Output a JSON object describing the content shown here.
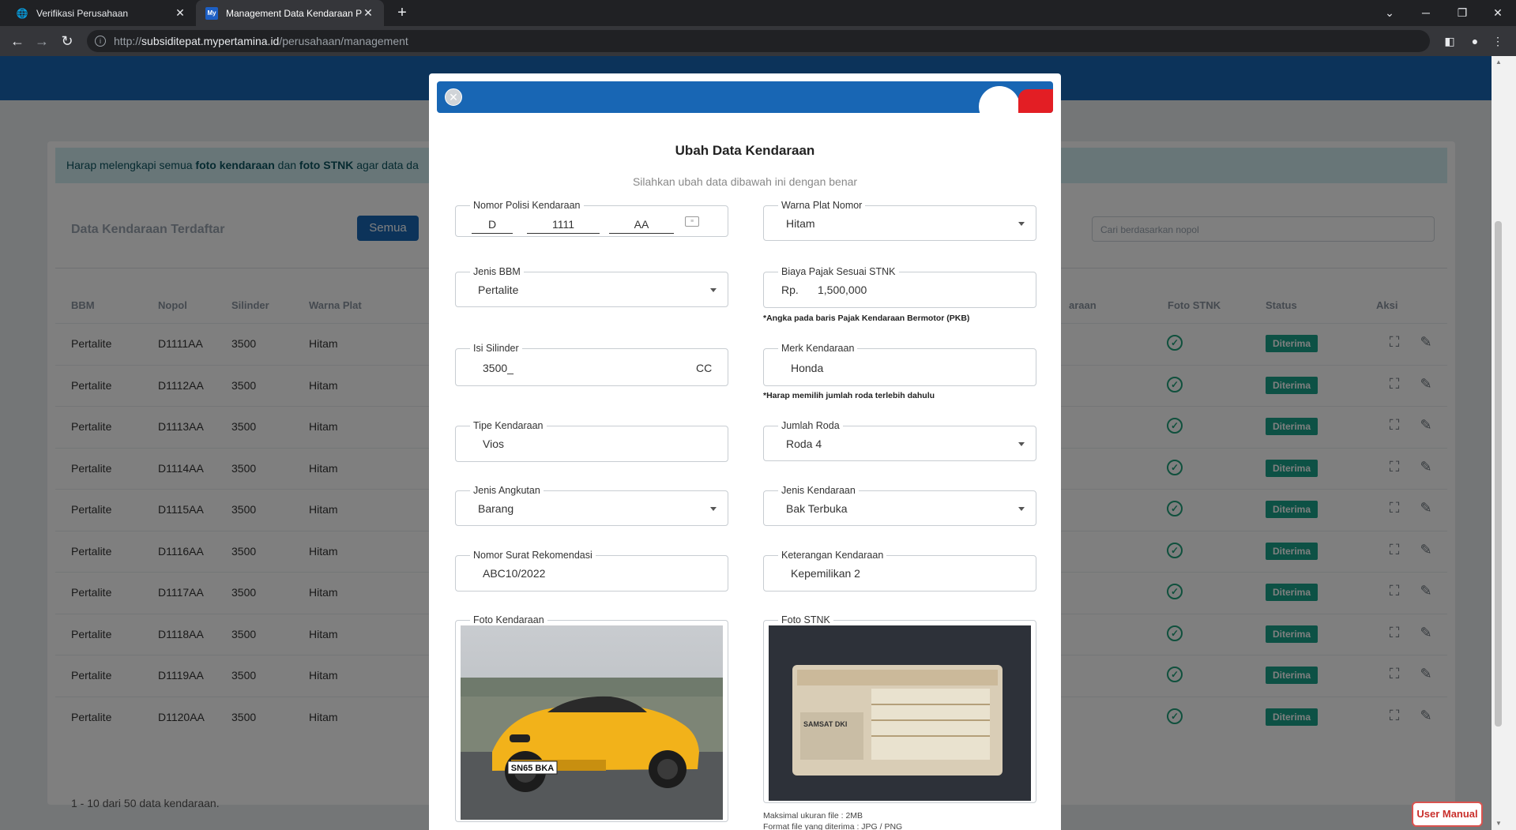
{
  "browser": {
    "tabs": [
      {
        "title": "Verifikasi Perusahaan",
        "active": false
      },
      {
        "title": "Management Data Kendaraan Pr",
        "active": true
      }
    ],
    "url_scheme": "http://",
    "url_host": "subsiditepat.mypertamina.id",
    "url_path": "/perusahaan/management"
  },
  "alert": {
    "text_pre": "Harap melengkapi semua ",
    "bold1": "foto kendaraan",
    "text_mid": " dan ",
    "bold2": "foto STNK",
    "text_post": " agar data da"
  },
  "table": {
    "title": "Data Kendaraan Terdaftar",
    "filter_label": "Semua",
    "search_placeholder": "Cari berdasarkan nopol",
    "headers": [
      "BBM",
      "Nopol",
      "Silinder",
      "Warna Plat",
      "",
      "araan",
      "Foto STNK",
      "Status",
      "Aksi"
    ],
    "rows": [
      {
        "bbm": "Pertalite",
        "nopol": "D1111AA",
        "silinder": "3500",
        "warna": "Hitam",
        "status": "Diterima"
      },
      {
        "bbm": "Pertalite",
        "nopol": "D1112AA",
        "silinder": "3500",
        "warna": "Hitam",
        "status": "Diterima"
      },
      {
        "bbm": "Pertalite",
        "nopol": "D1113AA",
        "silinder": "3500",
        "warna": "Hitam",
        "status": "Diterima"
      },
      {
        "bbm": "Pertalite",
        "nopol": "D1114AA",
        "silinder": "3500",
        "warna": "Hitam",
        "status": "Diterima"
      },
      {
        "bbm": "Pertalite",
        "nopol": "D1115AA",
        "silinder": "3500",
        "warna": "Hitam",
        "status": "Diterima"
      },
      {
        "bbm": "Pertalite",
        "nopol": "D1116AA",
        "silinder": "3500",
        "warna": "Hitam",
        "status": "Diterima"
      },
      {
        "bbm": "Pertalite",
        "nopol": "D1117AA",
        "silinder": "3500",
        "warna": "Hitam",
        "status": "Diterima"
      },
      {
        "bbm": "Pertalite",
        "nopol": "D1118AA",
        "silinder": "3500",
        "warna": "Hitam",
        "status": "Diterima"
      },
      {
        "bbm": "Pertalite",
        "nopol": "D1119AA",
        "silinder": "3500",
        "warna": "Hitam",
        "status": "Diterima"
      },
      {
        "bbm": "Pertalite",
        "nopol": "D1120AA",
        "silinder": "3500",
        "warna": "Hitam",
        "status": "Diterima"
      }
    ],
    "footer": "1 - 10 dari 50 data kendaraan."
  },
  "user_manual": "User Manual",
  "modal": {
    "title": "Ubah Data Kendaraan",
    "subtitle": "Silahkan ubah data dibawah ini dengan benar",
    "nomor_polisi": {
      "label": "Nomor Polisi Kendaraan",
      "prefix": "D",
      "number": "1111",
      "suffix": "AA"
    },
    "warna_plat": {
      "label": "Warna Plat Nomor",
      "value": "Hitam"
    },
    "jenis_bbm": {
      "label": "Jenis BBM",
      "value": "Pertalite"
    },
    "biaya_pajak": {
      "label": "Biaya Pajak Sesuai STNK",
      "currency": "Rp.",
      "value": "1,500,000",
      "hint": "*Angka pada baris Pajak Kendaraan Bermotor (PKB)"
    },
    "isi_silinder": {
      "label": "Isi Silinder",
      "value": "3500_",
      "unit": "CC"
    },
    "merk": {
      "label": "Merk Kendaraan",
      "value": "Honda",
      "hint": "*Harap memilih jumlah roda terlebih dahulu"
    },
    "tipe": {
      "label": "Tipe Kendaraan",
      "value": "Vios"
    },
    "jumlah_roda": {
      "label": "Jumlah Roda",
      "value": "Roda 4"
    },
    "jenis_angkutan": {
      "label": "Jenis Angkutan",
      "value": "Barang"
    },
    "jenis_kendaraan": {
      "label": "Jenis Kendaraan",
      "value": "Bak Terbuka"
    },
    "nomor_surat": {
      "label": "Nomor Surat Rekomendasi",
      "value": "ABC10/2022"
    },
    "keterangan": {
      "label": "Keterangan Kendaraan",
      "value": "Kepemilikan 2"
    },
    "foto_kendaraan": {
      "label": "Foto Kendaraan",
      "plate_text": "SN65 BKA"
    },
    "foto_stnk": {
      "label": "Foto STNK",
      "doc_text": "SAMSAT DKI"
    },
    "file_max": "Maksimal ukuran file : 2MB",
    "file_format": "Format file yang diterima : JPG / PNG"
  },
  "colors": {
    "brand_blue": "#1866b4",
    "brand_red": "#e31e24",
    "status_green": "#1aa38b"
  }
}
